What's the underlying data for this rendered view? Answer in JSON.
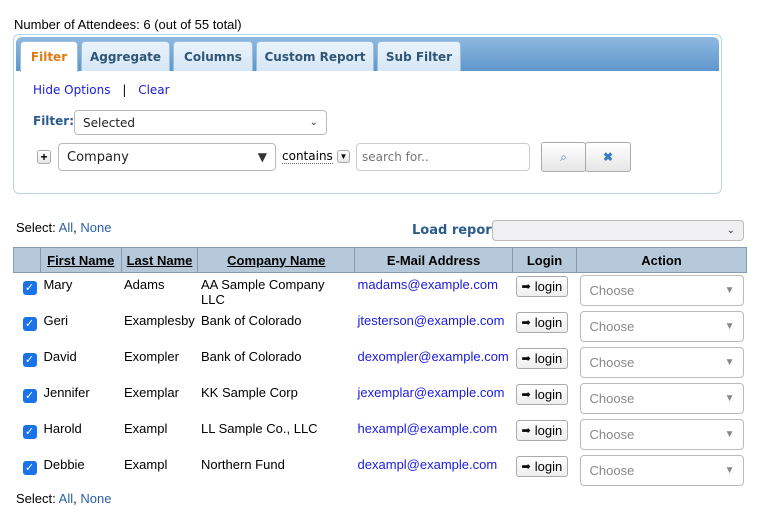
{
  "attendee_count": "Number of Attendees: 6 (out of 55 total)",
  "tabs": [
    "Filter",
    "Aggregate",
    "Columns",
    "Custom Report",
    "Sub Filter"
  ],
  "filter": {
    "hide_options": "Hide Options",
    "separator": "|",
    "clear": "Clear",
    "filter_label": "Filter:",
    "filter_value": "Selected",
    "field_value": "Company",
    "operator": "contains",
    "search_placeholder": "search for.."
  },
  "select": {
    "label": "Select:",
    "all": "All",
    "none": "None",
    "comma": ","
  },
  "load_report_label": "Load report:",
  "table": {
    "headers": [
      "First Name",
      "Last Name",
      "Company Name",
      "E-Mail Address",
      "Login",
      "Action"
    ],
    "login_label": "login",
    "action_placeholder": "Choose",
    "rows": [
      {
        "first": "Mary",
        "last": "Adams",
        "company": "AA Sample Company LLC",
        "email": "madams@example.com"
      },
      {
        "first": "Geri",
        "last": "Examplesby",
        "company": "Bank of Colorado",
        "email": "jtesterson@example.com"
      },
      {
        "first": "David",
        "last": "Exompler",
        "company": "Bank of Colorado",
        "email": "dexompler@example.com"
      },
      {
        "first": "Jennifer",
        "last": "Exemplar",
        "company": "KK Sample Corp",
        "email": "jexemplar@example.com"
      },
      {
        "first": "Harold",
        "last": "Exampl",
        "company": "LL Sample Co., LLC",
        "email": "hexampl@example.com"
      },
      {
        "first": "Debbie",
        "last": "Exampl",
        "company": "Northern Fund",
        "email": "dexampl@example.com"
      }
    ]
  }
}
